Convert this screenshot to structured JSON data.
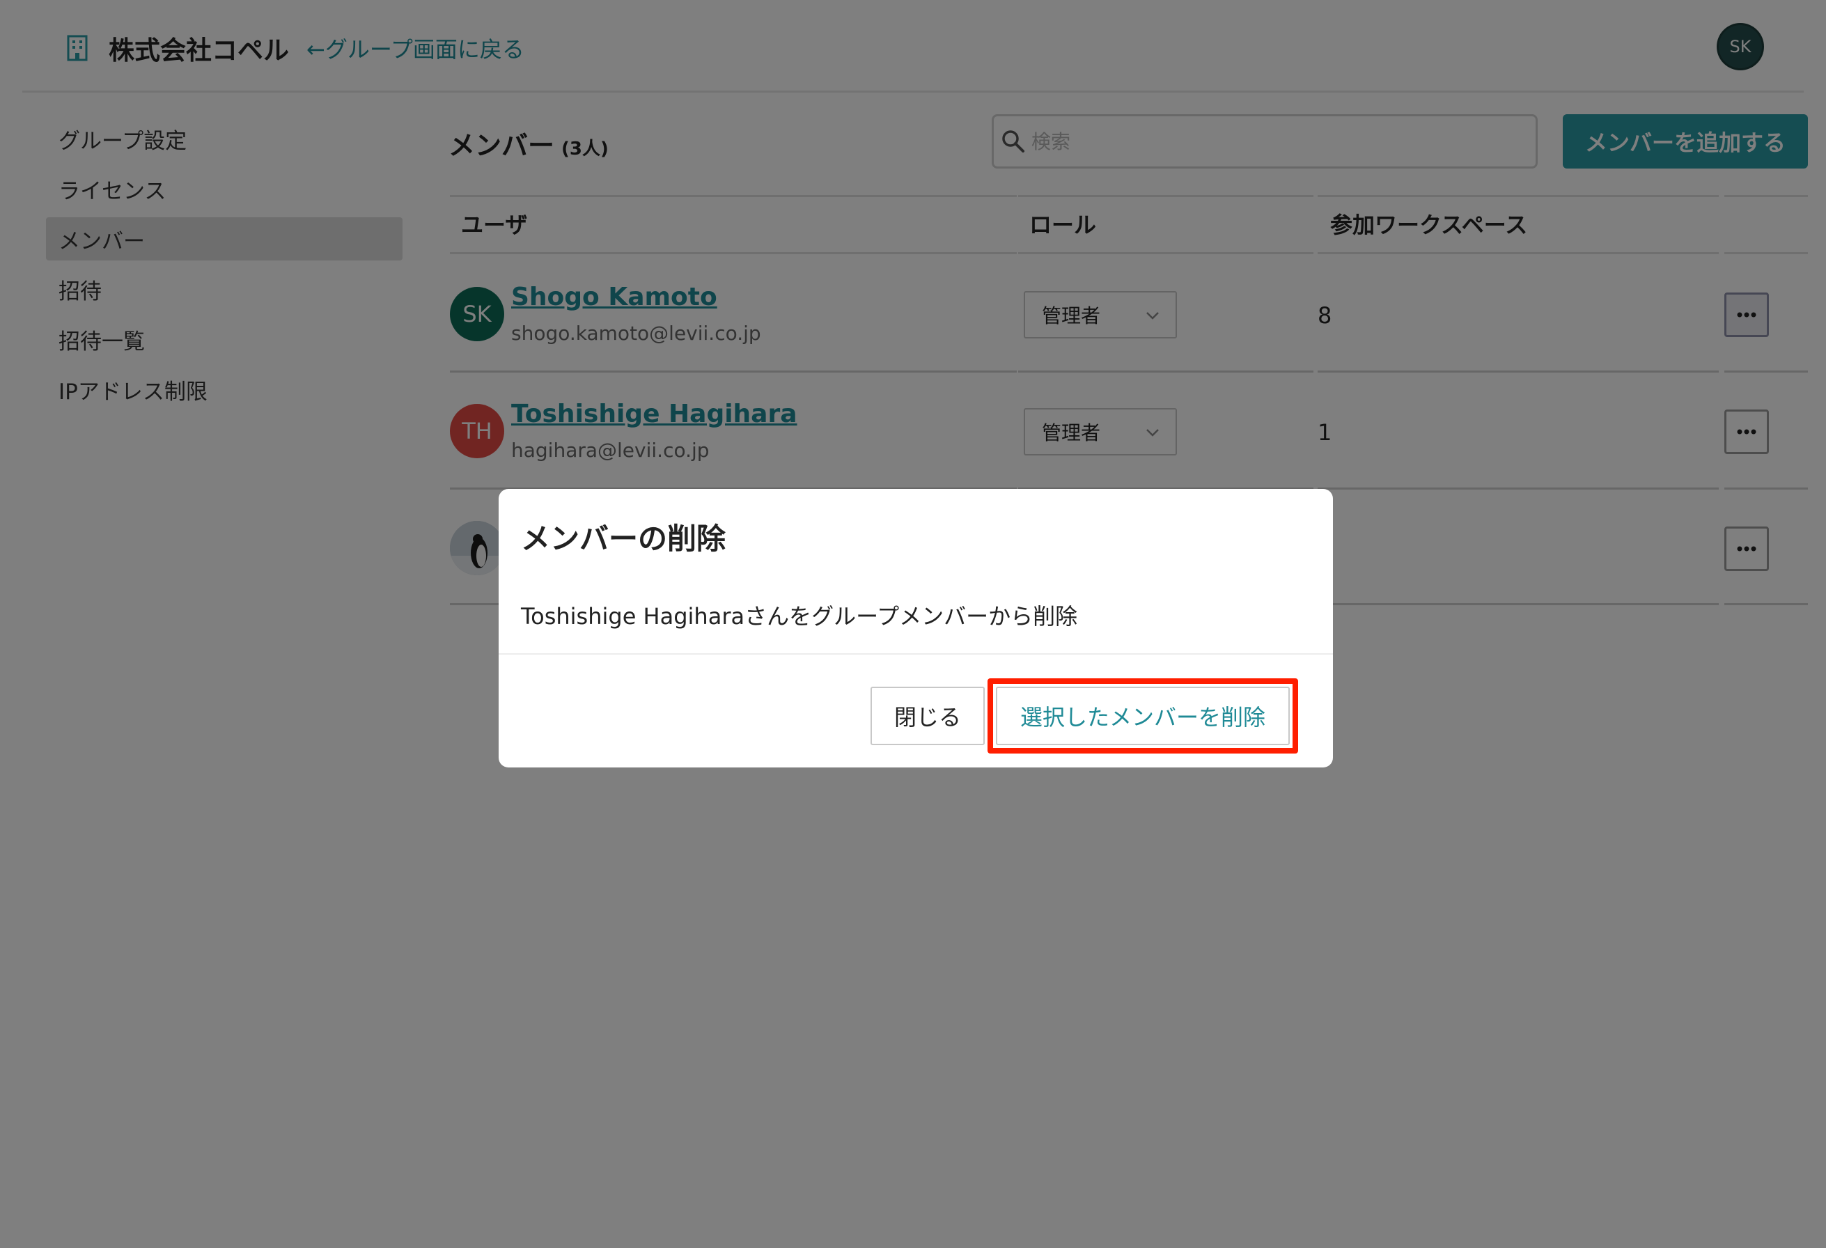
{
  "header": {
    "org_name": "株式会社コペル",
    "back_link": "←グループ画面に戻る",
    "avatar_initials": "SK"
  },
  "sidebar": {
    "items": [
      {
        "label": "グループ設定"
      },
      {
        "label": "ライセンス"
      },
      {
        "label": "メンバー",
        "active": true
      },
      {
        "label": "招待"
      },
      {
        "label": "招待一覧"
      },
      {
        "label": "IPアドレス制限"
      }
    ]
  },
  "main": {
    "title": "メンバー",
    "count": "(3人)",
    "search_placeholder": "検索",
    "add_button": "メンバーを追加する",
    "columns": [
      "ユーザ",
      "ロール",
      "参加ワークスペース"
    ],
    "rows": [
      {
        "initials": "SK",
        "name": "Shogo Kamoto",
        "email": "shogo.kamoto@levii.co.jp",
        "role": "管理者",
        "workspaces": "8",
        "avatar_color": "#0d6b57"
      },
      {
        "initials": "TH",
        "name": "Toshishige Hagihara",
        "email": "hagihara@levii.co.jp",
        "role": "管理者",
        "workspaces": "1",
        "avatar_color": "#e24a44"
      }
    ]
  },
  "dialog": {
    "title": "メンバーの削除",
    "message": "Toshishige Hagiharaさんをグループメンバーから削除",
    "close_button": "閉じる",
    "delete_button": "選択したメンバーを削除"
  },
  "colors": {
    "accent": "#2a9aa4",
    "link": "#1f8a96",
    "highlight": "#ff1e00"
  }
}
